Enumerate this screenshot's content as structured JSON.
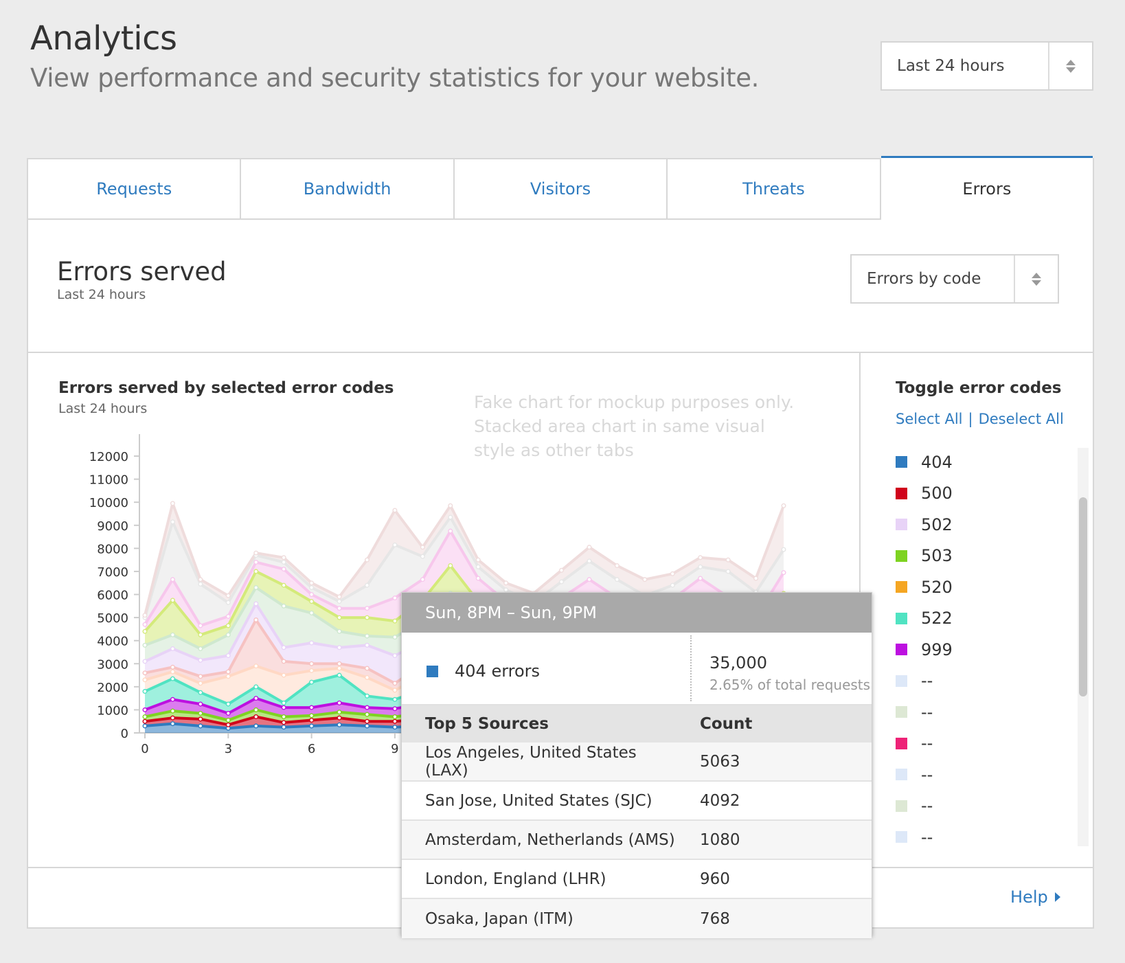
{
  "header": {
    "title": "Analytics",
    "subtitle": "View performance and security statistics for your website.",
    "time_range": "Last 24 hours"
  },
  "tabs": [
    {
      "label": "Requests",
      "active": false
    },
    {
      "label": "Bandwidth",
      "active": false
    },
    {
      "label": "Visitors",
      "active": false
    },
    {
      "label": "Threats",
      "active": false
    },
    {
      "label": "Errors",
      "active": true
    }
  ],
  "section": {
    "title": "Errors served",
    "subtitle": "Last 24 hours",
    "group_by": "Errors by code"
  },
  "chart": {
    "title": "Errors served by selected error codes",
    "subtitle": "Last 24 hours",
    "note": "Fake chart for mockup purposes only. Stacked area chart in same visual style as other tabs"
  },
  "toggle": {
    "title": "Toggle error codes",
    "select_all": "Select All",
    "separator": "|",
    "deselect_all": "Deselect All",
    "items": [
      {
        "label": "404",
        "color": "#2f7bbf"
      },
      {
        "label": "500",
        "color": "#d0021b"
      },
      {
        "label": "502",
        "color": "#e8d3f7"
      },
      {
        "label": "503",
        "color": "#7ed321"
      },
      {
        "label": "520",
        "color": "#f5a623"
      },
      {
        "label": "522",
        "color": "#50e3c2"
      },
      {
        "label": "999",
        "color": "#bd10e0"
      },
      {
        "label": "--",
        "color": "#dde8f8"
      },
      {
        "label": "--",
        "color": "#dde8d4"
      },
      {
        "label": "--",
        "color": "#ee2277"
      },
      {
        "label": "--",
        "color": "#dde8f8"
      },
      {
        "label": "--",
        "color": "#dde8d4"
      },
      {
        "label": "--",
        "color": "#dde8f8"
      }
    ]
  },
  "help": "Help",
  "tooltip": {
    "title": "Sun, 8PM – Sun, 9PM",
    "series_label": "404 errors",
    "value": "35,000",
    "percent": "2.65% of total requests",
    "col_source": "Top 5 Sources",
    "col_count": "Count",
    "rows": [
      {
        "source": "Los Angeles, United States (LAX)",
        "count": "5063"
      },
      {
        "source": "San Jose, United States (SJC)",
        "count": "4092"
      },
      {
        "source": "Amsterdam, Netherlands (AMS)",
        "count": "1080"
      },
      {
        "source": "London, England (LHR)",
        "count": "960"
      },
      {
        "source": "Osaka, Japan (ITM)",
        "count": "768"
      }
    ]
  },
  "chart_data": {
    "type": "area",
    "stacked": true,
    "x": [
      0,
      1,
      2,
      3,
      4,
      5,
      6,
      7,
      8,
      9,
      10,
      11,
      12,
      13,
      14,
      15,
      16,
      17,
      18,
      19,
      20,
      21,
      22,
      23
    ],
    "x_ticks": [
      0,
      3,
      6,
      9
    ],
    "y_ticks": [
      0,
      1000,
      2000,
      3000,
      4000,
      5000,
      6000,
      7000,
      8000,
      9000,
      10000,
      11000,
      12000
    ],
    "ylim": [
      0,
      12000
    ],
    "xlim": [
      0,
      23
    ],
    "series": [
      {
        "color": "#2f7bbf",
        "values": [
          300,
          400,
          300,
          200,
          300,
          250,
          300,
          350,
          300,
          250,
          300,
          400,
          350,
          300,
          250,
          300,
          350,
          300,
          250,
          300,
          350,
          300,
          250,
          300
        ]
      },
      {
        "color": "#d0021b",
        "values": [
          200,
          250,
          300,
          150,
          400,
          200,
          250,
          300,
          200,
          250,
          300,
          250,
          200,
          250,
          200,
          250,
          300,
          250,
          200,
          250,
          300,
          250,
          200,
          250
        ]
      },
      {
        "color": "#7ed321",
        "values": [
          200,
          300,
          250,
          200,
          300,
          250,
          200,
          250,
          300,
          200,
          250,
          300,
          250,
          200,
          300,
          250,
          200,
          250,
          300,
          200,
          250,
          300,
          250,
          200
        ]
      },
      {
        "color": "#bd10e0",
        "values": [
          300,
          500,
          400,
          300,
          500,
          400,
          350,
          400,
          300,
          350,
          400,
          500,
          400,
          350,
          300,
          350,
          400,
          350,
          300,
          350,
          400,
          350,
          300,
          400
        ]
      },
      {
        "color": "#50e3c2",
        "values": [
          800,
          900,
          500,
          400,
          500,
          200,
          1100,
          1200,
          500,
          400,
          600,
          900,
          700,
          500,
          400,
          500,
          600,
          500,
          400,
          500,
          600,
          500,
          400,
          700
        ]
      },
      {
        "color": "#ffd8c4",
        "values": [
          500,
          300,
          400,
          1200,
          900,
          1200,
          500,
          300,
          800,
          400,
          600,
          800,
          600,
          500,
          500,
          600,
          700,
          600,
          500,
          600,
          700,
          600,
          500,
          800
        ]
      },
      {
        "color": "#f6c2c2",
        "values": [
          300,
          200,
          300,
          200,
          2000,
          600,
          300,
          200,
          400,
          300,
          500,
          600,
          500,
          400,
          300,
          400,
          500,
          400,
          300,
          400,
          500,
          400,
          300,
          600
        ]
      },
      {
        "color": "#e8d3f7",
        "values": [
          500,
          800,
          700,
          700,
          700,
          600,
          900,
          700,
          1000,
          1200,
          1000,
          1200,
          900,
          800,
          700,
          800,
          900,
          800,
          700,
          800,
          900,
          800,
          700,
          1000
        ]
      },
      {
        "color": "#cfe8cf",
        "values": [
          700,
          600,
          500,
          900,
          700,
          1800,
          1300,
          700,
          400,
          800,
          900,
          1100,
          900,
          800,
          700,
          800,
          900,
          800,
          700,
          800,
          900,
          800,
          700,
          900
        ]
      },
      {
        "color": "#d4ea7a",
        "values": [
          600,
          1500,
          600,
          400,
          700,
          900,
          500,
          600,
          800,
          700,
          900,
          1200,
          900,
          800,
          700,
          800,
          900,
          800,
          700,
          800,
          900,
          800,
          700,
          900
        ]
      },
      {
        "color": "#f7c7ec",
        "values": [
          300,
          900,
          400,
          400,
          400,
          700,
          300,
          400,
          400,
          1000,
          900,
          1500,
          1000,
          800,
          700,
          800,
          900,
          800,
          700,
          800,
          900,
          800,
          700,
          900
        ]
      },
      {
        "color": "#e6e6e6",
        "values": [
          300,
          2500,
          1800,
          600,
          300,
          300,
          300,
          300,
          1000,
          2300,
          1000,
          600,
          500,
          500,
          600,
          700,
          800,
          800,
          900,
          600,
          500,
          1100,
          1100,
          1000
        ]
      },
      {
        "color": "#efdcdc",
        "values": [
          100,
          800,
          200,
          300,
          100,
          200,
          200,
          200,
          1100,
          1500,
          400,
          500,
          300,
          300,
          400,
          500,
          600,
          600,
          700,
          500,
          400,
          500,
          600,
          1900
        ]
      }
    ]
  }
}
